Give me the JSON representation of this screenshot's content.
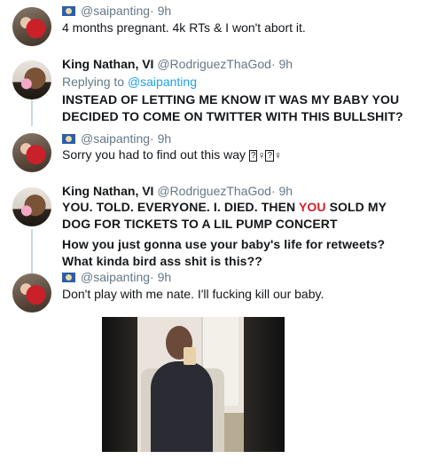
{
  "tweets": [
    {
      "handle": "@saipanting",
      "time": "· 9h",
      "text": "4 months pregnant. 4k RTs & I won't abort it."
    },
    {
      "name": "King Nathan, VI",
      "handle": "@RodriguezThaGod",
      "time": "· 9h",
      "replying_prefix": "Replying to ",
      "replying_to": "@saipanting",
      "line1": "INSTEAD OF LETTING ME KNOW IT WAS MY BABY YOU",
      "line2": "DECIDED TO COME ON TWITTER WITH THIS BULLSHIT?"
    },
    {
      "handle": "@saipanting",
      "time": "· 9h",
      "text": "Sorry you had to find out this way",
      "glyph_a": "?",
      "glyph_b": "♀",
      "glyph_c": "?",
      "glyph_d": "♀"
    },
    {
      "name": "King Nathan, VI",
      "handle": "@RodriguezThaGod",
      "time": "· 9h",
      "line1_a": "YOU. TOLD. EVERYONE. I. DIED. THEN ",
      "line1_red": "YOU",
      "line1_b": " SOLD MY",
      "line2": "DOG FOR TICKETS TO A LIL PUMP CONCERT",
      "line3": "How you just gonna use your baby's life for retweets?",
      "line4": "What kinda bird ass shit is this??"
    },
    {
      "handle": "@saipanting",
      "time": "· 9h",
      "text": "Don't play with me nate. I'll fucking kill our baby."
    }
  ],
  "icons": {
    "flag": "saipan-flag-icon",
    "avatar_1": "avatar",
    "avatar_2": "avatar"
  },
  "colors": {
    "link": "#1da1f2",
    "muted": "#657786",
    "highlight": "#d21f2b"
  }
}
